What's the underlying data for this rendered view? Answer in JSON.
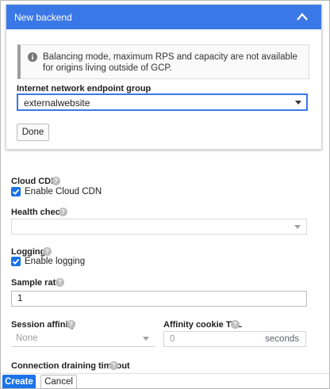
{
  "backend_panel": {
    "title": "New backend",
    "notice": "Balancing mode, maximum RPS and capacity are not available for origins living outside of GCP.",
    "neg_label": "Internet network endpoint group",
    "neg_value": "externalwebsite",
    "done_label": "Done"
  },
  "cloud_cdn": {
    "label": "Cloud CDN",
    "checkbox_label": "Enable Cloud CDN",
    "checked": true
  },
  "health_check": {
    "label": "Health check",
    "value": ""
  },
  "logging": {
    "label": "Logging",
    "checkbox_label": "Enable logging",
    "checked": true
  },
  "sample_rate": {
    "label": "Sample rate",
    "value": "1"
  },
  "session_affinity": {
    "label": "Session affinity",
    "value": "None"
  },
  "affinity_cookie_ttl": {
    "label": "Affinity cookie TTL",
    "value": "0",
    "unit": "seconds"
  },
  "connection_draining": {
    "label": "Connection draining timeout"
  },
  "actions": {
    "create_label": "Create",
    "cancel_label": "Cancel"
  },
  "icons": {
    "help": "?",
    "info": "info-icon",
    "collapse": "chevron-up-icon"
  },
  "colors": {
    "header_blue": "#3b78e7",
    "primary_button": "#1a73e8",
    "checkbox_blue": "#1a73e8"
  }
}
